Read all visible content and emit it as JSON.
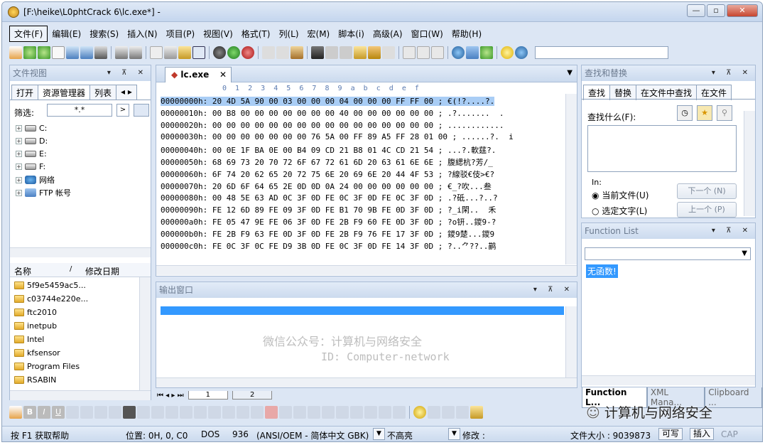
{
  "window": {
    "title": "[F:\\heike\\L0phtCrack 6\\lc.exe*] -"
  },
  "caption_buttons": {
    "minimize": "—",
    "restore": "▫",
    "close": "✕"
  },
  "menu": [
    "文件(F)",
    "编辑(E)",
    "搜索(S)",
    "插入(N)",
    "项目(P)",
    "视图(V)",
    "格式(T)",
    "列(L)",
    "宏(M)",
    "脚本(i)",
    "高级(A)",
    "窗口(W)",
    "帮助(H)"
  ],
  "file_view": {
    "title": "文件视图",
    "tabs": [
      "打开",
      "资源管理器",
      "列表"
    ],
    "filter_label": "筛选:",
    "filter_value": "*.*",
    "tree": [
      "C:",
      "D:",
      "E:",
      "F:",
      "网络",
      "FTP 帐号"
    ],
    "columns": {
      "name": "名称",
      "modified": "修改日期"
    },
    "folders": [
      "5f9e5459ac5...",
      "c03744e220e...",
      "ftc2010",
      "inetpub",
      "Intel",
      "kfsensor",
      "Program Files",
      "RSABIN"
    ]
  },
  "editor": {
    "tab_label": "lc.exe",
    "ruler": "0  1  2  3  4  5  6  7  8  9  a  b  c  d  e  f",
    "rows": [
      {
        "addr": "00000000h:",
        "hex": "20 4D 5A 90 00 03 00 00 00 04 00 00 00 FF FF 00 ;",
        "ascii": "€(!?....?."
      },
      {
        "addr": "00000010h:",
        "hex": "00 B8 00 00 00 00 00 00 00 40 00 00 00 00 00 00 ;",
        "ascii": ".?.......  ."
      },
      {
        "addr": "00000020h:",
        "hex": "00 00 00 00 00 00 00 00 00 00 00 00 00 00 00 00 ;",
        "ascii": "............"
      },
      {
        "addr": "00000030h:",
        "hex": "00 00 00 00 00 00 00 76 5A 00 FF 89 A5 FF 28 01 00 ;",
        "ascii": "......?.  i"
      },
      {
        "addr": "00000040h:",
        "hex": "00 0E 1F BA 0E 00 B4 09 CD 21 B8 01 4C CD 21 54 ;",
        "ascii": "...?.軟莛?."
      },
      {
        "addr": "00000050h:",
        "hex": "68 69 73 20 70 72 6F 67 72 61 6D 20 63 61 6E 6E ;",
        "ascii": "腹緦杭?芳/_"
      },
      {
        "addr": "00000060h:",
        "hex": "6F 74 20 62 65 20 72 75 6E 20 69 6E 20 44 4F 53 ;",
        "ascii": "?線驳€伎>€?"
      },
      {
        "addr": "00000070h:",
        "hex": "20 6D 6F 64 65 2E 0D 0D 0A 24 00 00 00 00 00 00 ;",
        "ascii": "€_?吹...叁"
      },
      {
        "addr": "00000080h:",
        "hex": "00 48 5E 63 AD 0C 3F 0D FE 0C 3F 0D FE 0C 3F 0D ;",
        "ascii": ".?砥...?..?"
      },
      {
        "addr": "00000090h:",
        "hex": "FE 12 6D 89 FE 09 3F 0D FE B1 70 9B FE 0D 3F 0D ;",
        "ascii": "?_i閑..  禾"
      },
      {
        "addr": "000000a0h:",
        "hex": "FE 05 47 9E FE 06 3F 0D FE 2B F9 60 FE 0D 3F 0D ;",
        "ascii": "?o钘..鑁9-?"
      },
      {
        "addr": "000000b0h:",
        "hex": "FE 2B F9 63 FE 0D 3F 0D FE 2B F9 76 FE 17 3F 0D ;",
        "ascii": "鑁9楚...鑁9"
      },
      {
        "addr": "000000c0h:",
        "hex": "FE 0C 3F 0C FE D9 3B 0D FE 0C 3F 0D FE 14 3F 0D ;",
        "ascii": "?..⺈??..鹋"
      }
    ]
  },
  "output": {
    "title": "输出窗口"
  },
  "watermark": {
    "line1": "微信公众号：计算机与网络安全",
    "line2": "ID: Computer-network",
    "logo": "计算机与网络安全"
  },
  "sheet_tabs": [
    "1",
    "2"
  ],
  "find_replace": {
    "title": "查找和替换",
    "tabs": [
      "查找",
      "替换",
      "在文件中查找",
      "在文件"
    ],
    "find_label": "查找什么(F):",
    "in_label": "In:",
    "options": [
      "当前文件(U)",
      "选定文字(L)"
    ],
    "next_btn": "下一个 (N)",
    "prev_btn": "上一个 (P)"
  },
  "function_list": {
    "title": "Function List",
    "empty": "无函数!"
  },
  "bottom_tabs": [
    "Function L...",
    "XML Mana...",
    "Clipboard ..."
  ],
  "status": {
    "help": "按 F1 获取帮助",
    "position": "位置: 0H, 0, C0",
    "format": "DOS",
    "codepage": "936",
    "encoding": "(ANSI/OEM - 简体中文 GBK)",
    "highlight": "不高亮",
    "modified_label": "修改 :",
    "filesize": "文件大小 : 9039873",
    "writable": "可写",
    "insert": "插入",
    "caps": "CAP"
  },
  "colors": {
    "accent": "#3399ff",
    "selection": "#a9cdf5",
    "panel_header": "#cbdaee"
  }
}
